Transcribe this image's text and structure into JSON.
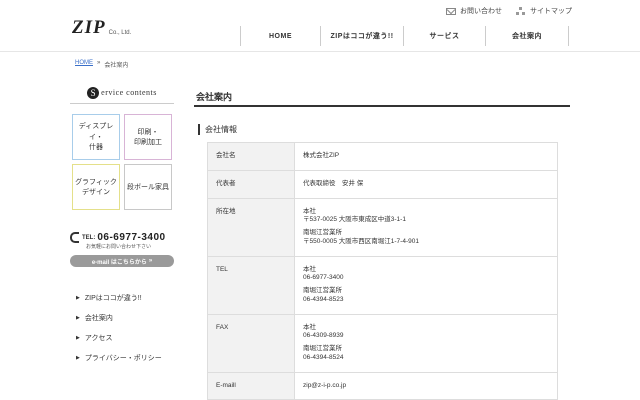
{
  "header": {
    "logo_main": "ZIP",
    "logo_sub": "Co., Ltd.",
    "utility": [
      {
        "icon": "mail-icon",
        "label": "お問い合わせ"
      },
      {
        "icon": "sitemap-icon",
        "label": "サイトマップ"
      }
    ],
    "nav": [
      "HOME",
      "ZIPはココが違う!!",
      "サービス",
      "会社案内"
    ]
  },
  "breadcrumb": {
    "home": "HOME",
    "sep": "»",
    "current": "会社案内"
  },
  "sidebar": {
    "title_initial": "S",
    "title_rest": "ervice contents",
    "services": [
      "ディスプレイ・\n什器",
      "印刷・\n印刷加工",
      "グラフィック\nデザイン",
      "段ボール家具"
    ],
    "tel_label": "TEL:",
    "tel_number": "06-6977-3400",
    "tel_note": "お気軽にお問い合わせ下さい",
    "mail_button": "e-mail はこちらから",
    "mail_button_arrow": "»",
    "menu_arrow": "▶",
    "menu": [
      "ZIPはココが違う!!",
      "会社案内",
      "アクセス",
      "プライバシー・ポリシー"
    ]
  },
  "main": {
    "page_title": "会社案内",
    "section_title": "会社情報",
    "rows": [
      {
        "label": "会社名",
        "blocks": [
          [
            "株式会社ZIP"
          ]
        ]
      },
      {
        "label": "代表者",
        "blocks": [
          [
            "代表取締役　安井 保"
          ]
        ]
      },
      {
        "label": "所在地",
        "blocks": [
          [
            "本社",
            "〒537-0025 大阪市東成区中道3-1-1"
          ],
          [
            "南堀江営業所",
            "〒550-0005 大阪市西区南堀江1-7-4-901"
          ]
        ]
      },
      {
        "label": "TEL",
        "blocks": [
          [
            "本社",
            "06-6977-3400"
          ],
          [
            "南堀江営業所",
            "06-4394-8523"
          ]
        ]
      },
      {
        "label": "FAX",
        "blocks": [
          [
            "本社",
            "06-4309-8939"
          ],
          [
            "南堀江営業所",
            "06-4394-8524"
          ]
        ]
      },
      {
        "label": "E-maill",
        "blocks": [
          [
            "zip@z-i-p.co.jp"
          ]
        ]
      }
    ]
  }
}
